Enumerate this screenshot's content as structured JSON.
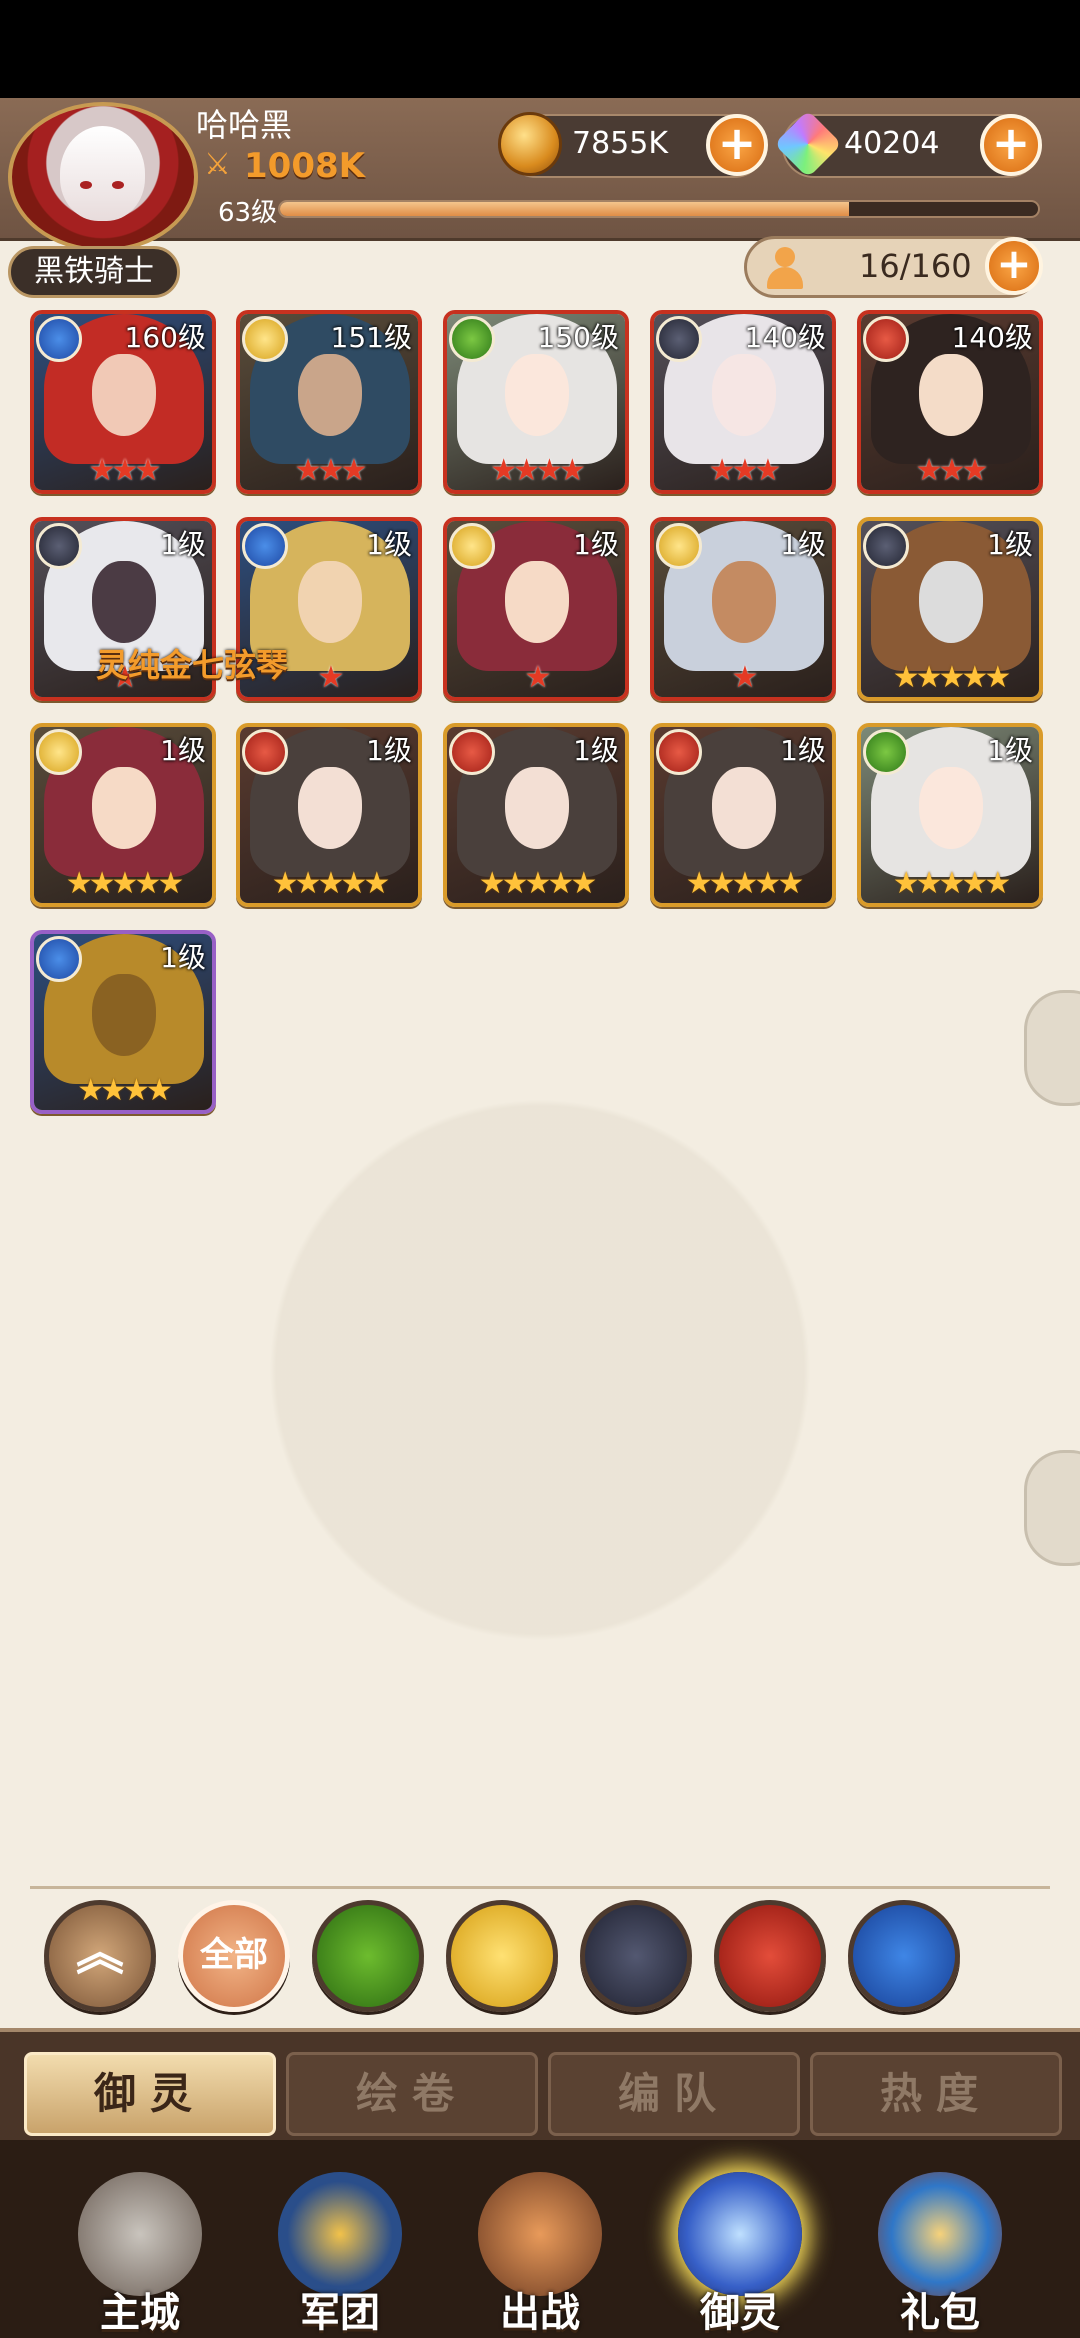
{
  "player": {
    "name": "哈哈黑",
    "power": "1008K",
    "level": "63级",
    "title": "黑铁骑士",
    "xp_fraction": 0.75
  },
  "currency": {
    "gold": "7855K",
    "gems": "40204"
  },
  "roster": {
    "count": "16/160"
  },
  "item_label": "灵纯金七弦琴",
  "heroes": [
    {
      "element": "water",
      "level": "160级",
      "stars": 3,
      "star_color": "red",
      "frame": "red",
      "hair": "#c22c25",
      "face": "#f1c9b6"
    },
    {
      "element": "light",
      "level": "151级",
      "stars": 3,
      "star_color": "red",
      "frame": "red",
      "hair": "#2f4b63",
      "face": "#c9a58a"
    },
    {
      "element": "nature",
      "level": "150级",
      "stars": 4,
      "star_color": "red",
      "frame": "red",
      "hair": "#e6e4e2",
      "face": "#fbe7dc"
    },
    {
      "element": "dark",
      "level": "140级",
      "stars": 3,
      "star_color": "red",
      "frame": "red",
      "hair": "#e8e4e8",
      "face": "#f6e6e4"
    },
    {
      "element": "fire",
      "level": "140级",
      "stars": 3,
      "star_color": "red",
      "frame": "red",
      "hair": "#2e2320",
      "face": "#f4dcc8"
    },
    {
      "element": "dark",
      "level": "1级",
      "stars": 1,
      "star_color": "red",
      "frame": "red",
      "hair": "#e8e8ec",
      "face": "#4b3b44"
    },
    {
      "element": "water",
      "level": "1级",
      "stars": 1,
      "star_color": "red",
      "frame": "red",
      "hair": "#d6b45c",
      "face": "#f1d3b0"
    },
    {
      "element": "light",
      "level": "1级",
      "stars": 1,
      "star_color": "red",
      "frame": "red",
      "hair": "#8a2c3a",
      "face": "#f6dac6"
    },
    {
      "element": "light",
      "level": "1级",
      "stars": 1,
      "star_color": "red",
      "frame": "red",
      "hair": "#c9d0dc",
      "face": "#c48b62"
    },
    {
      "element": "dark",
      "level": "1级",
      "stars": 5,
      "star_color": "gold",
      "frame": "gold",
      "hair": "#8a5a35",
      "face": "#dcdcdc"
    },
    {
      "element": "light",
      "level": "1级",
      "stars": 5,
      "star_color": "gold",
      "frame": "gold",
      "hair": "#8a2c3a",
      "face": "#f6dac6"
    },
    {
      "element": "fire",
      "level": "1级",
      "stars": 5,
      "star_color": "gold",
      "frame": "gold",
      "hair": "#4a403c",
      "face": "#f3dfd4"
    },
    {
      "element": "fire",
      "level": "1级",
      "stars": 5,
      "star_color": "gold",
      "frame": "gold",
      "hair": "#4a403c",
      "face": "#f3dfd4"
    },
    {
      "element": "fire",
      "level": "1级",
      "stars": 5,
      "star_color": "gold",
      "frame": "gold",
      "hair": "#4a403c",
      "face": "#f3dfd4"
    },
    {
      "element": "nature",
      "level": "1级",
      "stars": 5,
      "star_color": "gold",
      "frame": "gold",
      "hair": "#e6e4e2",
      "face": "#fbe7dc"
    },
    {
      "element": "water",
      "level": "1级",
      "stars": 4,
      "star_color": "gold",
      "frame": "purple",
      "hair": "#b88a2a",
      "face": "#8a6222"
    }
  ],
  "filters": {
    "all_label": "全部",
    "icons": [
      "collapse-icon",
      "all",
      "nature-element-icon",
      "light-element-icon",
      "dark-element-icon",
      "fire-element-icon",
      "water-element-icon"
    ]
  },
  "subtabs": [
    "御灵",
    "绘卷",
    "编队",
    "热度"
  ],
  "nav": [
    {
      "label": "主城",
      "icon": "castle-icon"
    },
    {
      "label": "军团",
      "icon": "legion-shield-icon"
    },
    {
      "label": "出战",
      "icon": "battle-gate-icon"
    },
    {
      "label": "御灵",
      "icon": "crystal-icon"
    },
    {
      "label": "礼包",
      "icon": "gift-shop-icon"
    }
  ]
}
